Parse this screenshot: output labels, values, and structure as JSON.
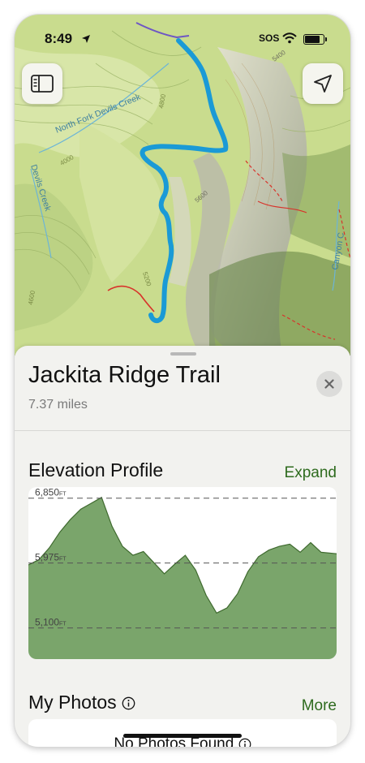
{
  "status_bar": {
    "time": "8:49",
    "sos": "SOS",
    "icons": [
      "location-arrow-icon",
      "wifi-icon",
      "battery-icon"
    ]
  },
  "map": {
    "labels": {
      "north_fork": "North Fork Devils Creek",
      "devils_creek": "Devils Creek",
      "canyon_creek": "Canyon C",
      "contour_4800": "4800",
      "contour_4000": "4000",
      "contour_5200": "5200",
      "contour_4600": "4600",
      "contour_5600": "5600",
      "contour_5400": "5400"
    },
    "buttons": {
      "sidebar": "sidebar-toggle-icon",
      "locate": "location-arrow-icon"
    },
    "colors": {
      "route": "#1a9ad6",
      "terrain": "#c9dc8e",
      "red_trail": "#d8322a"
    }
  },
  "sheet": {
    "title": "Jackita Ridge Trail",
    "distance": "7.37 miles",
    "close_icon": "close-icon"
  },
  "elevation": {
    "heading": "Elevation Profile",
    "expand": "Expand",
    "unit": "FT",
    "grid_labels": [
      "6,850",
      "5,975",
      "5,100"
    ],
    "fill_color": "#7aa56b"
  },
  "chart_data": {
    "type": "area",
    "x": [
      0,
      0.25,
      0.5,
      0.75,
      1,
      1.25,
      1.5,
      1.75,
      2,
      2.25,
      2.5,
      2.75,
      3,
      3.25,
      3.5,
      3.75,
      4,
      4.25,
      4.5,
      4.75,
      5,
      5.25,
      5.5,
      5.75,
      6,
      6.25,
      6.5,
      6.75,
      7,
      7.37
    ],
    "y": [
      5950,
      6020,
      6180,
      6390,
      6560,
      6700,
      6780,
      6860,
      6470,
      6200,
      6080,
      6130,
      5980,
      5830,
      5960,
      6080,
      5880,
      5540,
      5300,
      5370,
      5560,
      5860,
      6060,
      6150,
      6200,
      6230,
      6120,
      6250,
      6120,
      6100
    ],
    "series_color": "#7aa56b",
    "ylim": [
      4680,
      7000
    ],
    "xlim": [
      0,
      7.37
    ],
    "gridlines": [
      6850,
      5975,
      5100
    ],
    "grid": true
  },
  "photos": {
    "heading": "My Photos",
    "more": "More",
    "empty": "No Photos Found"
  }
}
